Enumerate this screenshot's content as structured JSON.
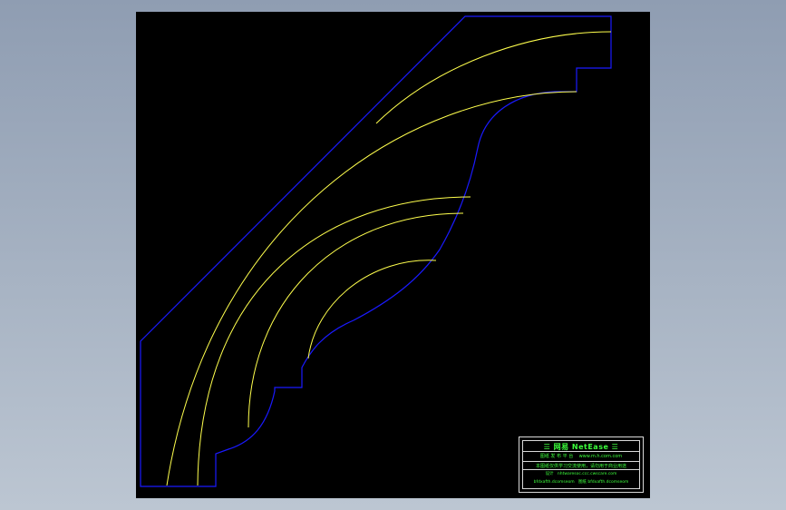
{
  "colors": {
    "background": "#98a6b8",
    "viewport": "#000000",
    "profile_outline": "#1a1aff",
    "arc_lines": "#ffff4d",
    "title_block_text": "#3cff3c",
    "title_block_border": "#d9d9d9"
  },
  "title_block": {
    "brand": "☰ 网易 NetEase ☰",
    "row2_left": "图纸 发 布 平 台",
    "row2_right": "www.m.h.com.com",
    "row3": "本图纸仅供学习交流使用，请勿用于商业用途",
    "row4_left": "设计",
    "row4_right": "nhtwaresoc.ccc.cwscare.com",
    "row5_left": "bfdxafth.dcomseom",
    "row5_right": "图纸 bfdxafth.dcomseom"
  }
}
